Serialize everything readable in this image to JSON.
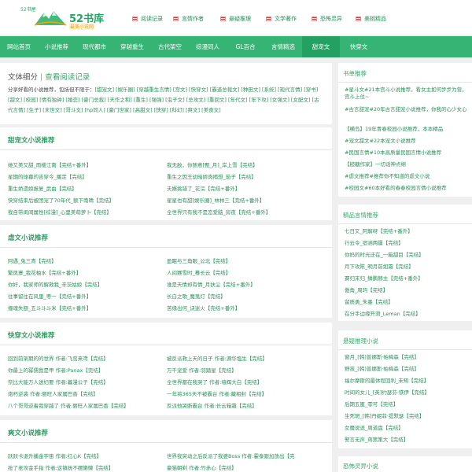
{
  "header": {
    "logo_sub": "52书屋",
    "logo_name": "52书库",
    "logo_slogan": "最美小说网",
    "top_links": [
      "阅读记录",
      "言情作者",
      "悬疑推理",
      "文学著作",
      "恐怖灵异",
      "美桃精品"
    ]
  },
  "nav": [
    "网站首页",
    "小说推荐",
    "现代都市",
    "穿越重生",
    "古代架空",
    "综漫同人",
    "GL百合",
    "言情精选",
    "甜宠文",
    "快穿文"
  ],
  "category": {
    "title": "文体细分",
    "sep": "|",
    "link": "查看阅读记录",
    "intro": "分享好看的小说推荐，包括但不限于：",
    "tags": "[甜宠文] [娱乐圈] [穿越重生言情] [宫文] [快穿文] [霸道总裁文] [种田文] [系统] [现代言情] [穿书] [甜文] [校园] [情有独钟] [婚恋] [豪门总裁] [天作之和] [重生] [强强] [虫子文] [总攻文] [重回文] [年代文] [年下攻] [女强文] [女配文] [古代言情] [生子] [末世文] [哥斗文] [hp同人] [豪门世家] [高甜文] [快穿] [科幻] [爽文] [美食文]"
  },
  "sections": [
    {
      "title": "甜宠文小说推荐",
      "left": [
        "她又美又甜_雨楼江南【完结+番外】",
        "星期的球幕的吉穿今_播定【完结】",
        "重生娇遗娘报复_武由【完结】",
        "快穿结束后被团宠了70年代_额下南晴【完结】",
        "我自带闺闺属性[综漫]_心里美萌萝卜【完结】"
      ],
      "right": [
        "我无敌，你随意[甄_月]_岸上雪【完结】",
        "重生之因王幼暗娇肉揭想_茹子【完结】",
        "夫婿挑错了_花浣【完结+番外】",
        "星星也有甜[娱乐圈]_林林三【完结+番外】",
        "全世界只有我不是恋爱脑_房夜【完结+番外】"
      ]
    },
    {
      "title": "虐文小说推荐",
      "left": [
        "阿遇_兔三青【完结】",
        "繁凤寨_我花柚水【完结+番外】",
        "你好，我家师的解救我_辛茨姑娘【完结】",
        "往事留往在风里_枣一【完结+番外】",
        "撞魂失额_五斗斗斗米【完结+番外】"
      ],
      "right": [
        "盈眠与三角眼_公北【完结】",
        "人间赛雪时_蓦长云【完结】",
        "谁是天情却有情_月扶尘【完结+番外】",
        "长白之歌_魔鬼灯【完结】",
        "苦缘出何_诀迷火【完结+番外】"
      ]
    },
    {
      "title": "快穿文小说推荐",
      "left": [
        "回到前架期的的世界 作者:飞鸾来鸢【完结】",
        "你最上的幂儒我是甲 作者:Panax【完结】",
        "奈比大能万人送妇要 作者:暮漫公子【完结】",
        "炮朽逆袭 作者:丽旺人家属巴香【完结】",
        "八个哥哥逆着我穿越了 作者:丽旺人家属巴香【完结】"
      ],
      "right": [
        "被反派救上天的日子 作者:源华塩生【完结】",
        "万千宠爱 作者:羽踏星【完结】",
        "全世界都在我哭了 作者:墙辉大白【完结】",
        "一年将365天不被霸台 作者:藏相封【完结】",
        "反派他哭断霸台 作者:长云箱霜【完结】"
      ]
    },
    {
      "title": "爽文小说推荐",
      "left": [
        "跃跃卡退升播金宇宙 作者:红心K【完结】",
        "抢了老攻金手指 作者:这镇抚不摆懒懒【完结】"
      ],
      "right": [
        "世界我突动之后反派了我婆Boss 作者:霍泰跟加放出【完",
        "豪猫朝剃 作者:竹赤心【完结】"
      ]
    }
  ],
  "sidebar": {
    "book_list": {
      "title": "书单推荐",
      "items": [
        "#星斗文#21本宫斗小说推荐，看女主如何步步为营，宫斗上位~",
        "#古言甜宠#20年古言甜宠小说推荐，你我的心少女心",
        "【横岛】19年青春校园小说推荐，本本精品",
        "#宠文甜文#22本宠文小说推荐",
        "#民国言情#10本高质量民国言情小说推荐",
        "【糙糖作家】一切话神点绵",
        "#虐文推荐#推荐你不知道的虐文小说",
        "#校园文#60本好看的春春校园言情小说推荐"
      ]
    },
    "romance": {
      "title": "精品言情推荐",
      "items": [
        "七日又_阿解呀【完结+番外】",
        "行云令_宿涵两疆【完结】",
        "你妈的时光迂在_一箱甜目【完结】",
        "月下攻陈_明月前如霜【完结】",
        "賽归末归_鳞鹏赫主【完结+番外】",
        "傲角_周玙【完结】",
        "留质勇_朱墨【完结】",
        "在分手边缘开滑_Leman【完结】"
      ]
    },
    "mystery": {
      "title": "悬疑推理小说",
      "items": [
        "窗月_[韩]普娜斯·帕梅森【完结】",
        "野孩_[韩]普娜斯·帕梅森【完结】",
        "福尔摩斯的最体程回利_未知【完结】",
        "时间的女儿_[英]约瑟芬·铁伊【完结】",
        "后期五匿_零可【完结】",
        "生死斑_[韩]丹妮菲·提默瑟【完结】",
        "女魔说说_周道盘【完结】",
        "警言无声_蒋策策大【完结】"
      ]
    },
    "horror": {
      "title": "恐怖灵异小说"
    }
  }
}
